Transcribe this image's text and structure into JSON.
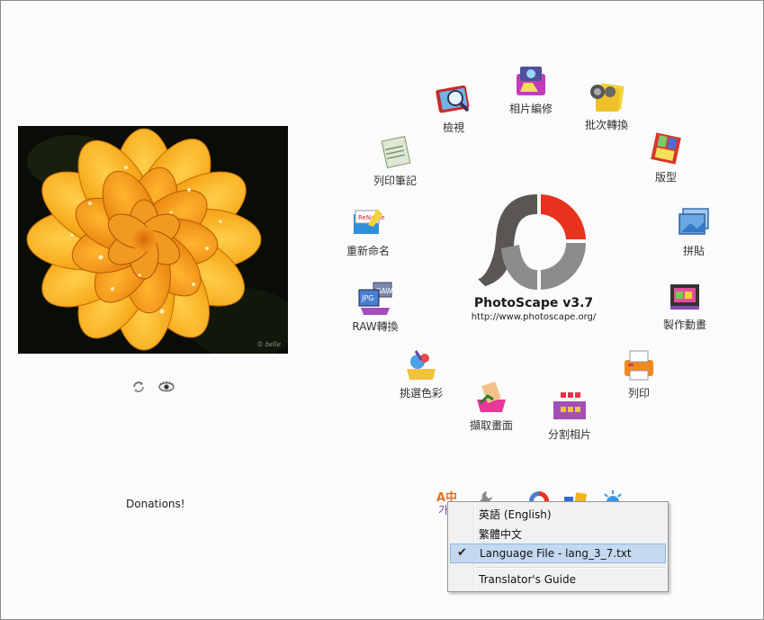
{
  "app": {
    "name": "PhotoScape v3.7",
    "url": "http://www.photoscape.org/"
  },
  "left": {
    "donate_label": "Donations!",
    "photo_credit": "© belle"
  },
  "menu": [
    {
      "label": "檢視",
      "icon": "viewer-icon"
    },
    {
      "label": "相片編修",
      "icon": "editor-icon"
    },
    {
      "label": "批次轉換",
      "icon": "batch-editor-icon"
    },
    {
      "label": "版型",
      "icon": "page-layout-icon"
    },
    {
      "label": "拼貼",
      "icon": "combine-icon"
    },
    {
      "label": "製作動畫",
      "icon": "animated-gif-icon"
    },
    {
      "label": "列印",
      "icon": "print-icon"
    },
    {
      "label": "分割相片",
      "icon": "splitter-icon"
    },
    {
      "label": "擷取畫面",
      "icon": "screen-capture-icon"
    },
    {
      "label": "挑選色彩",
      "icon": "color-picker-icon"
    },
    {
      "label": "RAW轉換",
      "icon": "raw-converter-icon"
    },
    {
      "label": "重新命名",
      "icon": "rename-icon"
    },
    {
      "label": "列印筆記",
      "icon": "paper-print-icon"
    }
  ],
  "toolbar": {
    "language_icon_text": "A中",
    "language_icon_text2": "가"
  },
  "context_menu": {
    "items": [
      {
        "label": "英語 (English)",
        "checked": false
      },
      {
        "label": "繁體中文",
        "checked": false
      },
      {
        "label": "Language File - lang_3_7.txt",
        "checked": true
      },
      {
        "label": "Translator's Guide",
        "checked": false
      }
    ],
    "check_glyph": "✔"
  },
  "colors": {
    "logo_red": "#e8321e",
    "logo_gray": "#8c8c8c",
    "logo_dark": "#595654",
    "selection": "#c4d9f0"
  }
}
